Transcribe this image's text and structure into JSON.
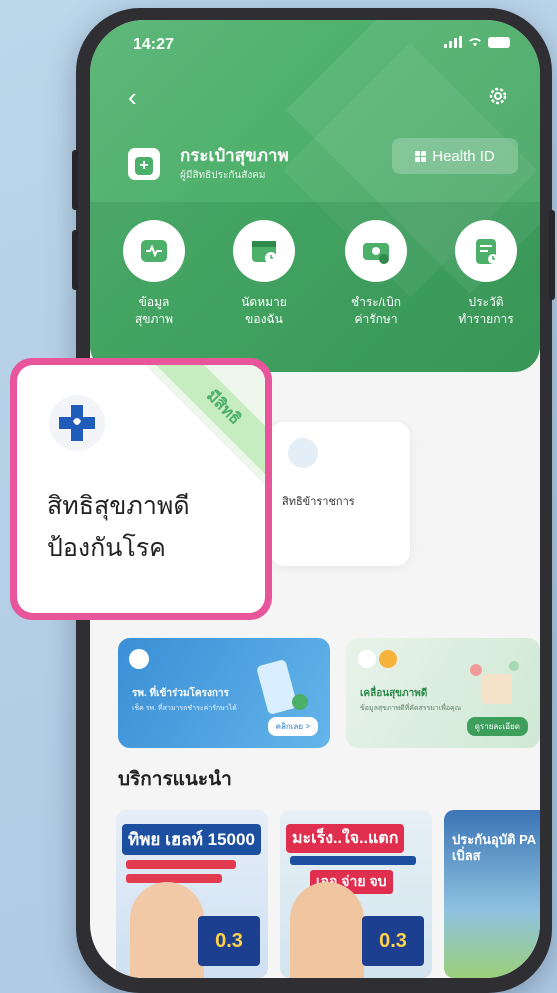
{
  "status_bar": {
    "time": "14:27"
  },
  "header": {
    "title": "กระเป๋าสุขภาพ",
    "subtitle": "ผู้มีสิทธิประกันสังคม",
    "health_id_label": "Health ID"
  },
  "menu": [
    {
      "line1": "ข้อมูล",
      "line2": "สุขภาพ",
      "icon": "health-info-icon"
    },
    {
      "line1": "นัดหมาย",
      "line2": "ของฉัน",
      "icon": "calendar-icon"
    },
    {
      "line1": "ชำระ/เบิก",
      "line2": "ค่ารักษา",
      "icon": "payment-icon"
    },
    {
      "line1": "ประวัติ",
      "line2": "ทำรายการ",
      "icon": "history-icon"
    }
  ],
  "rights_card": {
    "label": "สิทธิข้าราชการ"
  },
  "popup": {
    "badge": "มีสิทธิ",
    "title_line1": "สิทธิสุขภาพดี",
    "title_line2": "ป้องกันโรค"
  },
  "banners": [
    {
      "title": "รพ. ที่เข้าร่วมโครงการ",
      "desc": "เช็ค รพ. ที่สามารถชำระค่ารักษาได้",
      "button": "คลิกเลย >"
    },
    {
      "title": "เคลื่อนสุขภาพดี",
      "desc": "ข้อมูลสุขภาพดีที่คัดสรรมาเพื่อคุณ",
      "button": "ดูรายละเอียด"
    }
  ],
  "section": {
    "title": "บริการแนะนำ"
  },
  "promos": [
    {
      "headline": "ทิพย เฮลท์ 15000",
      "price": "0.3"
    },
    {
      "headline": "มะเร็ง..ใจ..แตก",
      "sub": "เจอ จ่าย จบ",
      "price": "0.3"
    },
    {
      "headline": "ประกันอุบัติ PA เบิ่ลส"
    }
  ],
  "colors": {
    "brand_green": "#4caf6a",
    "popup_border": "#e9559a",
    "ribbon": "#c6ecc0"
  }
}
